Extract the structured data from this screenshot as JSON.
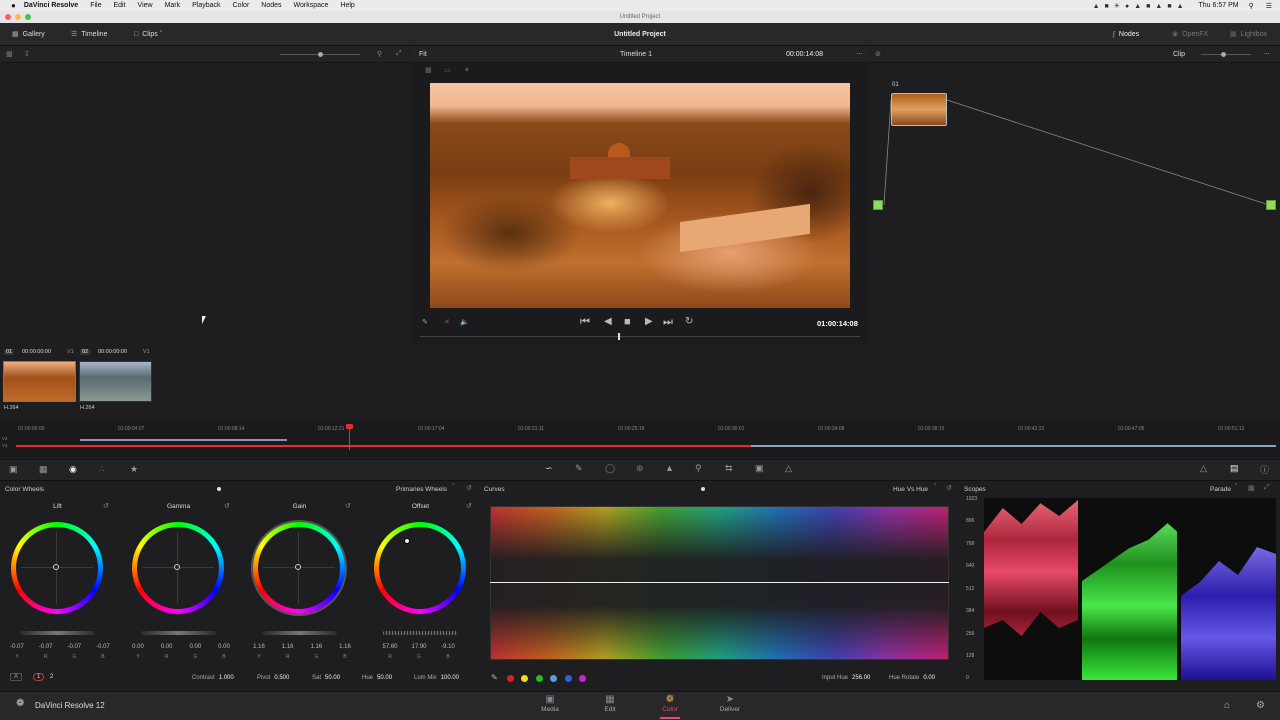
{
  "menubar": {
    "apple": "",
    "app_name": "DaVinci Resolve",
    "items": [
      "File",
      "Edit",
      "View",
      "Mark",
      "Playback",
      "Color",
      "Nodes",
      "Workspace",
      "Help"
    ],
    "clock": "Thu 6:57 PM"
  },
  "window": {
    "title": "Untitled Project"
  },
  "toolbar": {
    "gallery": "Gallery",
    "timeline": "Timeline",
    "clips": "Clips",
    "project_title": "Untitled Project",
    "nodes": "Nodes",
    "openfx": "OpenFX",
    "lightbox": "Lightbox"
  },
  "viewer": {
    "fit": "Fit",
    "timeline_name": "Timeline 1",
    "timecode_top": "00:00:14:08",
    "timecode": "01:00:14:08"
  },
  "node_editor": {
    "clip_mode": "Clip",
    "node_label": "01"
  },
  "clips": [
    {
      "index": "01",
      "timecode": "00:00:00:00",
      "track": "V1",
      "codec": "H.264"
    },
    {
      "index": "02",
      "timecode": "00:00:00:00",
      "track": "V1",
      "codec": "H.264"
    }
  ],
  "timeline": {
    "tracks": [
      "V1",
      "V2"
    ],
    "ticks": [
      "01:00:00:00",
      "01:00:04:07",
      "01:00:08:14",
      "01:00:12:21",
      "01:00:17:04",
      "01:00:21:11",
      "01:00:25:18",
      "01:00:30:01",
      "01:00:34:08",
      "01:00:38:15",
      "01:00:42:22",
      "01:00:47:05",
      "01:00:51:12"
    ]
  },
  "color_wheels": {
    "title": "Color Wheels",
    "mode": "Primaries Wheels",
    "wheels": [
      {
        "name": "Lift",
        "values": [
          "-0.07",
          "-0.07",
          "-0.07",
          "-0.07"
        ],
        "labels": [
          "Y",
          "R",
          "G",
          "B"
        ]
      },
      {
        "name": "Gamma",
        "values": [
          "0.00",
          "0.00",
          "0.00",
          "0.00"
        ],
        "labels": [
          "Y",
          "R",
          "G",
          "B"
        ]
      },
      {
        "name": "Gain",
        "values": [
          "1.16",
          "1.16",
          "1.16",
          "1.16"
        ],
        "labels": [
          "Y",
          "R",
          "G",
          "B"
        ]
      },
      {
        "name": "Offset",
        "values": [
          "57.60",
          "17.90",
          "-9.10"
        ],
        "labels": [
          "R",
          "G",
          "B"
        ]
      }
    ],
    "pages": [
      "1",
      "2"
    ],
    "contrast_label": "Contrast",
    "contrast": "1.000",
    "pivot_label": "Pivot",
    "pivot": "0.500",
    "sat_label": "Sat",
    "sat": "50.00",
    "hue_label": "Hue",
    "hue": "50.00",
    "lummix_label": "Lum Mix",
    "lummix": "100.00"
  },
  "curves": {
    "title": "Curves",
    "mode": "Hue Vs Hue",
    "input_hue_label": "Input Hue",
    "input_hue": "256.00",
    "hue_rotate_label": "Hue Rotate",
    "hue_rotate": "0.00",
    "swatches": [
      "#e02020",
      "#e8e020",
      "#20c020",
      "#30d0d0",
      "#3060e0",
      "#d020d0"
    ]
  },
  "scopes": {
    "title": "Scopes",
    "mode": "Parade",
    "scale": [
      "1023",
      "896",
      "768",
      "640",
      "512",
      "384",
      "256",
      "128",
      "0"
    ]
  },
  "dock": {
    "brand": "DaVinci Resolve 12",
    "tabs": [
      "Media",
      "Edit",
      "Color",
      "Deliver"
    ],
    "active": "Color"
  }
}
